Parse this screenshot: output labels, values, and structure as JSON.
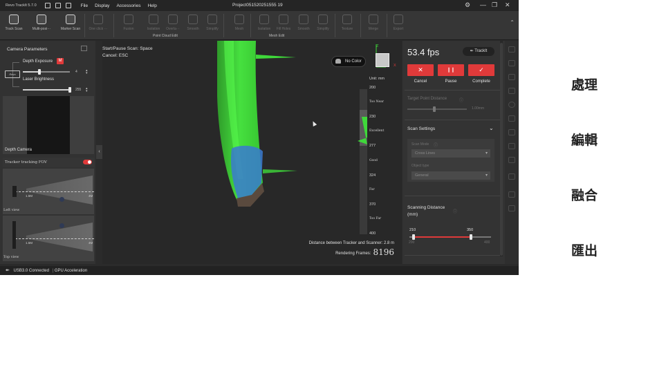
{
  "app": {
    "title": "Revo TrackIt 5.7.0",
    "project": "Project051520251555 19",
    "menus": [
      "File",
      "Display",
      "Accessories",
      "Help"
    ],
    "window_controls": [
      "⚙",
      "—",
      "❐",
      "✕"
    ]
  },
  "ribbon": {
    "buttons": [
      "Track Scan",
      "Multi-posi···",
      "Marker Scan",
      "One click ···",
      "Fusion",
      "Isolation",
      "Overla···",
      "Smooth",
      "Simplify",
      "Mesh",
      "Isolation",
      "Fill Holes",
      "Smooth",
      "Simplify",
      "Texture",
      "Merge",
      "Export"
    ],
    "groups": {
      "point_cloud_edit": "Point Cloud Edit",
      "mesh_edit": "Mesh Edit"
    }
  },
  "left_panel": {
    "title": "Camera Parameters",
    "depth_exposure_label": "Depth Exposure",
    "depth_exposure_mode": "M",
    "depth_exposure_value": "4",
    "depth_exposure_level": 0.35,
    "laser_brightness_label": "Laser Brightness",
    "laser_brightness_value": "255",
    "laser_brightness_level": 1.0,
    "logo_text": "Revo",
    "depth_camera_label": "Depth Camera",
    "tracker_label": "Tracker tracking FOV",
    "tracker_enabled": true,
    "left_view": {
      "near": "1.5M",
      "far": "4M",
      "label": "Left view"
    },
    "top_view": {
      "near": "1.5M",
      "far": "4M",
      "label": "Top view"
    }
  },
  "viewport": {
    "start_pause_label": "Start/Pause Scan:",
    "start_pause_key": "Space",
    "cancel_label": "Cancel:",
    "cancel_key": "ESC",
    "no_color": "No Color",
    "unit": "Unit: mm",
    "scale_ticks": [
      "200",
      "Too Near",
      "230",
      "Excellent",
      "277",
      "Good",
      "324",
      "Far",
      "370",
      "Too Far",
      "400"
    ],
    "distance_text": "Distance between Tracker and Scanner: 2.8 m",
    "rendering_label": "Rendering Frames:",
    "rendering_value": "8196",
    "axis_labels": {
      "z": "Z",
      "x": "X"
    }
  },
  "right_panel": {
    "fps": "53.4 fps",
    "trackit": "TrackIt",
    "actions": [
      {
        "icon": "✕",
        "label": "Cancel"
      },
      {
        "icon": "❙❙",
        "label": "Pause"
      },
      {
        "icon": "✓",
        "label": "Complete"
      }
    ],
    "target_point_distance_label": "Target Point Distance",
    "target_point_distance_value": "1.00mm",
    "scan_settings_label": "Scan Settings",
    "scan_mode_label": "Scan Mode",
    "scan_mode_value": "Cross Lines",
    "object_type_label": "Object type",
    "object_type_value": "General",
    "scanning_distance_label": "Scanning Distance",
    "scanning_distance_unit": "(mm)",
    "range_low": "210",
    "range_high": "350",
    "range_min": "200",
    "range_max": "400"
  },
  "status": {
    "usb": "USB3.0 Connected",
    "gpu": "GPU Acceleration"
  },
  "side_labels": [
    "處理",
    "編輯",
    "融合",
    "匯出"
  ],
  "colors": {
    "accent": "#e03a3a",
    "cloud_green": "#3fd83a",
    "cloud_blue": "#3a7ad0"
  }
}
